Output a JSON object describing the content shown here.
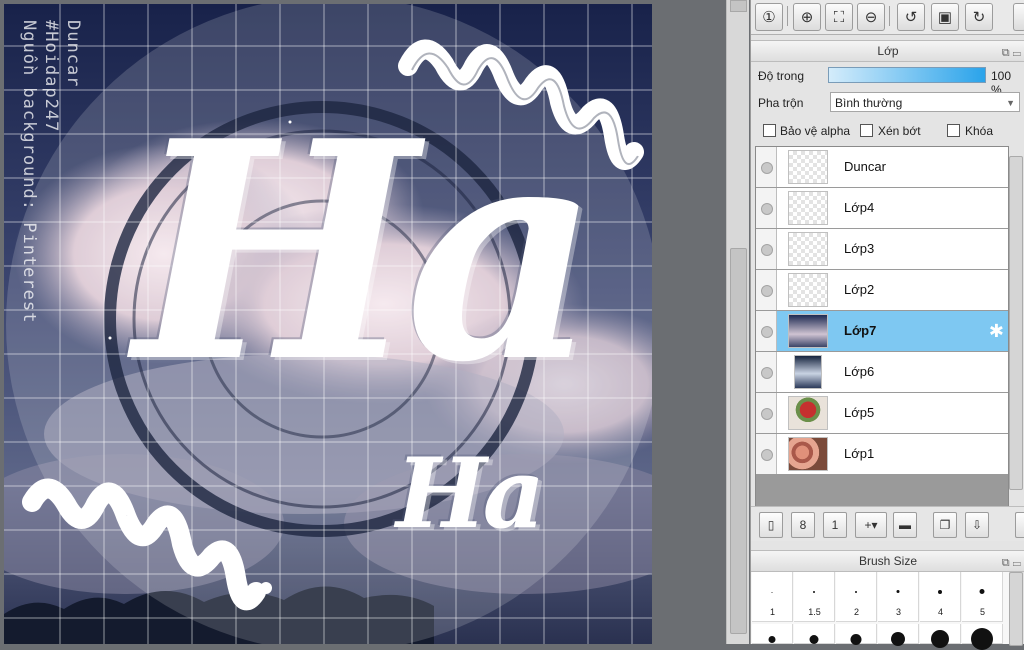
{
  "canvas": {
    "side_text": [
      "Duncar",
      "#Hoidap247",
      "Nguồn background: Pinterest"
    ],
    "big_title": "Ha",
    "small_title": "Ha",
    "colors": {
      "sky_dark": "#1b2547",
      "cloud_pink": "#e9d5de",
      "ink": "#1d2540"
    }
  },
  "toolbar": {
    "buttons": [
      {
        "name": "zoom-actual-icon",
        "glyph": "①"
      },
      {
        "name": "zoom-in-icon",
        "glyph": "⊕"
      },
      {
        "name": "fit-window-icon",
        "glyph": "⛶"
      },
      {
        "name": "zoom-out-icon",
        "glyph": "⊖"
      },
      {
        "name": "rotate-left-icon",
        "glyph": "↺"
      },
      {
        "name": "fit-canvas-icon",
        "glyph": "▣"
      },
      {
        "name": "rotate-right-icon",
        "glyph": "↻"
      }
    ]
  },
  "layers_panel": {
    "title": "Lớp",
    "opacity_label": "Độ trong",
    "opacity_value": "100 %",
    "opacity_fraction": 1.0,
    "blend_label": "Pha trộn",
    "blend_value": "Bình thường",
    "options": {
      "protect_alpha": "Bảo vệ alpha",
      "clipping": "Xén bớt",
      "lock": "Khóa"
    },
    "accent": "#7ec8f2",
    "layers": [
      {
        "name": "Duncar",
        "thumb": "text",
        "selected": false
      },
      {
        "name": "Lớp4",
        "thumb": "transparent",
        "selected": false
      },
      {
        "name": "Lớp3",
        "thumb": "transparent",
        "selected": false
      },
      {
        "name": "Lớp2",
        "thumb": "transparent",
        "selected": false
      },
      {
        "name": "Lớp7",
        "thumb": "clouds",
        "selected": true
      },
      {
        "name": "Lớp6",
        "thumb": "sky",
        "selected": false
      },
      {
        "name": "Lớp5",
        "thumb": "flowers",
        "selected": false
      },
      {
        "name": "Lớp1",
        "thumb": "roses",
        "selected": false
      }
    ]
  },
  "brush_panel": {
    "title": "Brush Size",
    "sizes": [
      "1",
      "1.5",
      "2",
      "3",
      "4",
      "5"
    ]
  }
}
